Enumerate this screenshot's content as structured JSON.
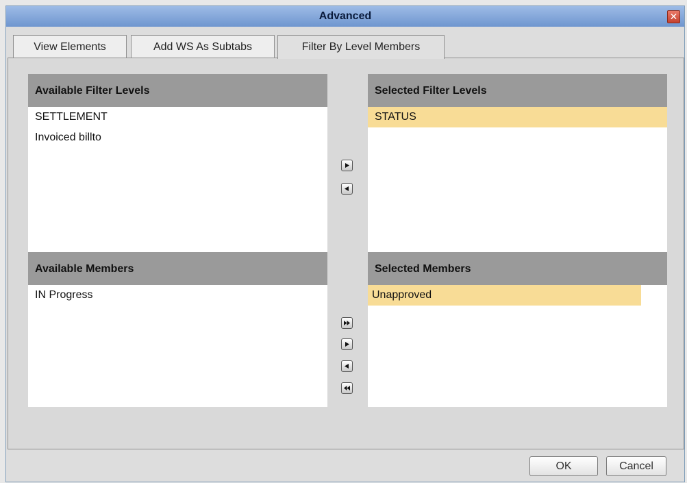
{
  "window": {
    "title": "Advanced",
    "close_symbol": "✕"
  },
  "tabs": [
    {
      "label": "View Elements"
    },
    {
      "label": "Add WS As Subtabs"
    },
    {
      "label": "Filter By Level Members",
      "active": true
    }
  ],
  "available_filter_levels": {
    "header": "Available Filter Levels",
    "items": [
      "SETTLEMENT",
      "Invoiced billto"
    ]
  },
  "selected_filter_levels": {
    "header": "Selected Filter Levels",
    "items": [
      "STATUS"
    ]
  },
  "available_members": {
    "header": "Available Members",
    "items": [
      "IN Progress"
    ]
  },
  "selected_members": {
    "header": "Selected Members",
    "items": [
      "Unapproved"
    ]
  },
  "buttons": {
    "ok": "OK",
    "cancel": "Cancel"
  },
  "icons": {
    "move_right": "arrow-right-icon",
    "move_left": "arrow-left-icon",
    "move_all_right": "double-arrow-right-icon",
    "move_all_left": "double-arrow-left-icon"
  },
  "colors": {
    "selection": "#f8dc96",
    "list_header": "#9a9a9a",
    "title_bar": "#8aaee0"
  }
}
